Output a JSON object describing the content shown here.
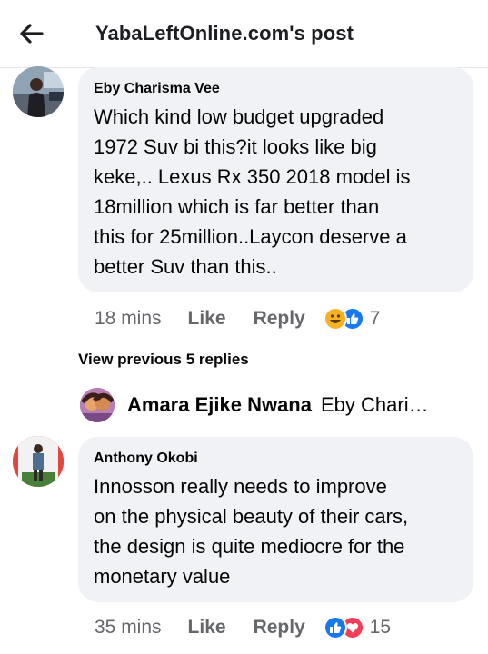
{
  "header": {
    "title": "YabaLeftOnline.com's post"
  },
  "comments": [
    {
      "author": "Eby Charisma Vee",
      "text": "Which kind low budget  upgraded\n1972 Suv bi this?it looks like big\nkeke,.. Lexus Rx 350 2018 model is\n18million which is far better than\nthis for 25million..Laycon deserve a\nbetter Suv than this..",
      "time": "18 mins",
      "like_label": "Like",
      "reply_label": "Reply",
      "reactions": [
        "haha",
        "like"
      ],
      "reaction_count": "7"
    },
    {
      "author": "Anthony Okobi",
      "text": "Innosson really needs to improve\non the physical beauty of their cars,\nthe design is quite mediocre for the\nmonetary value",
      "time": "35 mins",
      "like_label": "Like",
      "reply_label": "Reply",
      "reactions": [
        "like",
        "love"
      ],
      "reaction_count": "15"
    }
  ],
  "replies": {
    "view_previous": "View previous 5 replies",
    "latest_reply": {
      "author": "Amara Ejike Nwana",
      "snippet": "Eby Chari…"
    }
  },
  "colors": {
    "bubble": "#f0f2f5",
    "secondary_text": "#65676b",
    "like_blue": "#1877f2",
    "love_red": "#f33e58",
    "haha_yellow": "#f7b125"
  }
}
